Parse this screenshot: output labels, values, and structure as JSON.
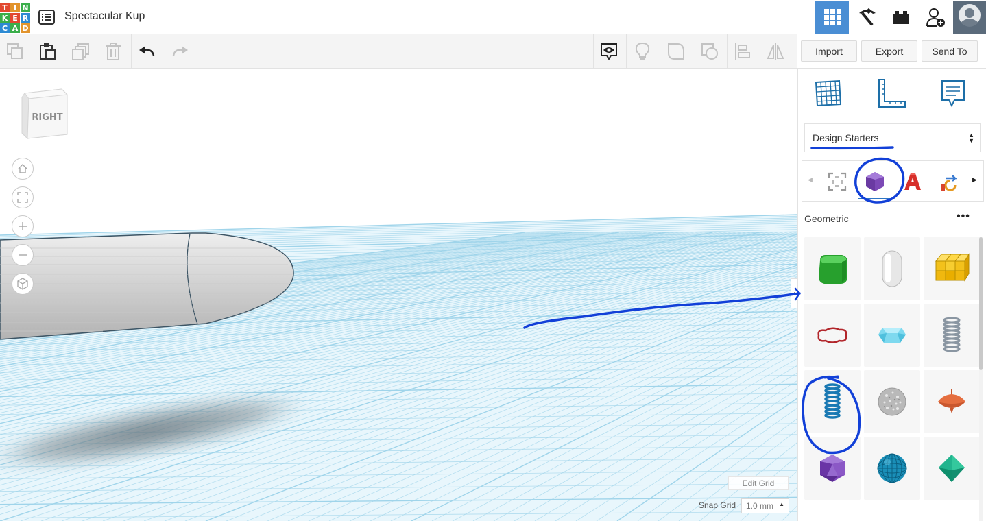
{
  "app": {
    "logo_letters": [
      "T",
      "I",
      "N",
      "K",
      "E",
      "R",
      "C",
      "A",
      "D"
    ],
    "logo_colors": [
      "#e24830",
      "#e2942c",
      "#3aae4a",
      "#3aae4a",
      "#e24830",
      "#2d8ad3",
      "#2d8ad3",
      "#3aae4a",
      "#e2942c"
    ],
    "design_title": "Spectacular Kup"
  },
  "topnav": [
    "3d-design-grid",
    "codeblocks-pickaxe",
    "bricks",
    "add-user",
    "user-avatar"
  ],
  "toolbar": {
    "buttons": [
      "copy",
      "paste",
      "duplicate",
      "delete",
      "undo",
      "redo"
    ],
    "view_buttons": [
      "show-hide",
      "light",
      "group",
      "ungroup",
      "align",
      "mirror"
    ],
    "import_label": "Import",
    "export_label": "Export",
    "send_to_label": "Send To"
  },
  "workplane": {
    "viewcube_face": "RIGHT",
    "edit_grid_label": "Edit Grid",
    "snap_grid_label": "Snap Grid",
    "snap_grid_value": "1.0 mm",
    "grid_color": "#9fd4ea",
    "grid_bg": "#e8f6fc"
  },
  "panel": {
    "library_select": "Design Starters",
    "categories": [
      "featured",
      "geometric",
      "text",
      "connectors"
    ],
    "active_category": "geometric",
    "section_title": "Geometric",
    "more_label": "•••",
    "shapes": [
      "rounded-cube",
      "capsule",
      "cube-grid",
      "torus-thin",
      "gem",
      "spring-gray",
      "spring-blue",
      "sphere-textured",
      "spinning-top",
      "icosahedron",
      "geodesic-sphere",
      "octahedron"
    ]
  },
  "annotation_color": "#1240d8"
}
